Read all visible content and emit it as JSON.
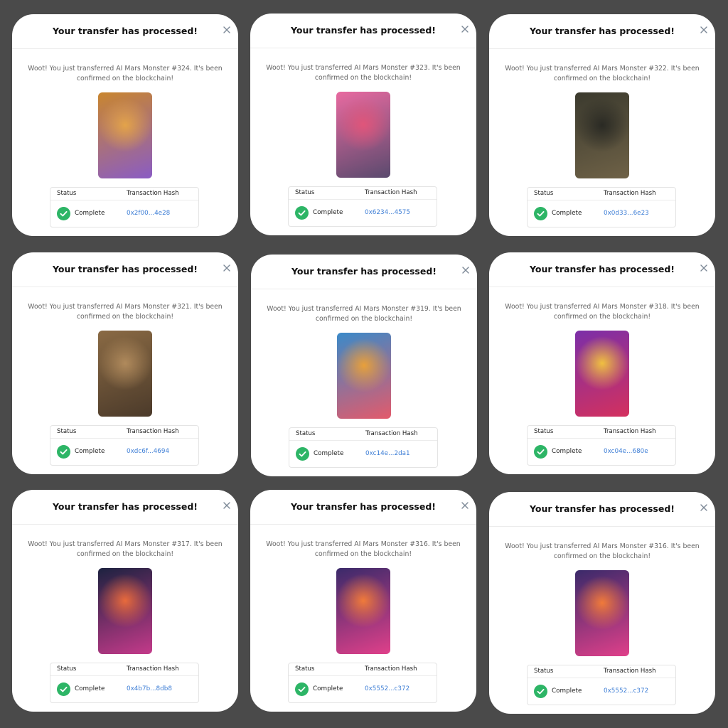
{
  "modals": [
    {
      "title": "Your transfer has processed!",
      "message": "Woot! You just transferred AI Mars Monster #324. It's been confirmed on the blockchain!",
      "status_header": "Status",
      "hash_header": "Transaction Hash",
      "status": "Complete",
      "hash": "0x2f00...4e28",
      "image_colors": [
        "#c9862e",
        "#8a5cc4",
        "#e3a34a"
      ]
    },
    {
      "title": "Your transfer has processed!",
      "message": "Woot! You just transferred AI Mars Monster #323. It's been confirmed on the blockchain!",
      "status_header": "Status",
      "hash_header": "Transaction Hash",
      "status": "Complete",
      "hash": "0x6234...4575",
      "image_colors": [
        "#e86aa0",
        "#5a4a6e",
        "#e0557a"
      ]
    },
    {
      "title": "Your transfer has processed!",
      "message": "Woot! You just transferred AI Mars Monster #322. It's been confirmed on the blockchain!",
      "status_header": "Status",
      "hash_header": "Transaction Hash",
      "status": "Complete",
      "hash": "0x0d33...6e23",
      "image_colors": [
        "#3b3a2e",
        "#6f6247",
        "#2a2a24"
      ]
    },
    {
      "title": "Your transfer has processed!",
      "message": "Woot! You just transferred AI Mars Monster #321. It's been confirmed on the blockchain!",
      "status_header": "Status",
      "hash_header": "Transaction Hash",
      "status": "Complete",
      "hash": "0xdc6f...4694",
      "image_colors": [
        "#8a6a44",
        "#4b3a2a",
        "#b08a5c"
      ]
    },
    {
      "title": "Your transfer has processed!",
      "message": "Woot! You just transferred AI Mars Monster #319. It's been confirmed on the blockchain!",
      "status_header": "Status",
      "hash_header": "Transaction Hash",
      "status": "Complete",
      "hash": "0xc14e...2da1",
      "image_colors": [
        "#3a8ac9",
        "#e35a6b",
        "#e8a03a"
      ]
    },
    {
      "title": "Your transfer has processed!",
      "message": "Woot! You just transferred AI Mars Monster #318. It's been confirmed on the blockchain!",
      "status_header": "Status",
      "hash_header": "Transaction Hash",
      "status": "Complete",
      "hash": "0xc04e...680e",
      "image_colors": [
        "#7b2fa8",
        "#d4305e",
        "#f0c040"
      ]
    },
    {
      "title": "Your transfer has processed!",
      "message": "Woot! You just transferred AI Mars Monster #317. It's been confirmed on the blockchain!",
      "status_header": "Status",
      "hash_header": "Transaction Hash",
      "status": "Complete",
      "hash": "0x4b7b...8db8",
      "image_colors": [
        "#1c2240",
        "#c43a8a",
        "#e86a3c"
      ]
    },
    {
      "title": "Your transfer has processed!",
      "message": "Woot! You just transferred AI Mars Monster #316. It's been confirmed on the blockchain!",
      "status_header": "Status",
      "hash_header": "Transaction Hash",
      "status": "Complete",
      "hash": "0x5552...c372",
      "image_colors": [
        "#3a2a6a",
        "#e0408a",
        "#f07a3a"
      ]
    },
    {
      "title": "Your transfer has processed!",
      "message": "Woot! You just transferred AI Mars Monster #316. It's been confirmed on the blockchain!",
      "status_header": "Status",
      "hash_header": "Transaction Hash",
      "status": "Complete",
      "hash": "0x5552...c372",
      "image_colors": [
        "#3a2a6a",
        "#e0408a",
        "#f07a3a"
      ]
    }
  ],
  "icons": {
    "close": "close-icon",
    "check": "check-icon"
  },
  "colors": {
    "background": "#4a4a4a",
    "success": "#2db566",
    "link": "#3f7fd6"
  }
}
